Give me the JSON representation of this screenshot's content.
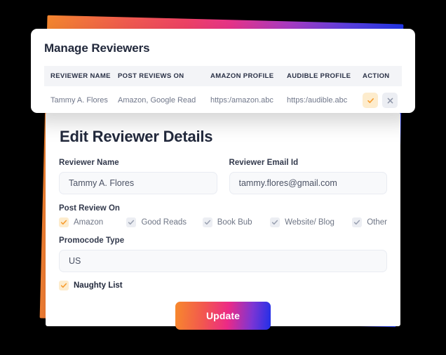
{
  "manage_panel": {
    "title": "Manage Reviewers",
    "table": {
      "columns": [
        "REVIEWER NAME",
        "POST REVIEWS ON",
        "AMAZON PROFILE",
        "AUDIBLE PROFILE",
        "ACTION"
      ],
      "rows": [
        {
          "reviewer_name": "Tammy A. Flores",
          "post_reviews_on": "Amazon, Google Read",
          "amazon_profile": "https:/amazon.abc",
          "audible_profile": "https:/audible.abc",
          "actions": {
            "approve_icon": "check-icon",
            "remove_icon": "close-icon"
          }
        }
      ]
    }
  },
  "edit_panel": {
    "title": "Edit Reviewer Details",
    "fields": {
      "reviewer_name": {
        "label": "Reviewer Name",
        "value": "Tammy A. Flores",
        "placeholder": "Reviewer Name"
      },
      "reviewer_email": {
        "label": "Reviewer Email Id",
        "value": "tammy.flores@gmail.com",
        "placeholder": "Reviewer Email Id"
      },
      "promocode_type": {
        "label": "Promocode Type",
        "value": "US",
        "placeholder": "Promocode Type"
      }
    },
    "post_review_on": {
      "label": "Post Review On",
      "options": [
        {
          "label": "Amazon",
          "checked": true,
          "highlight": true
        },
        {
          "label": "Good Reads",
          "checked": true,
          "highlight": false
        },
        {
          "label": "Book Bub",
          "checked": true,
          "highlight": false
        },
        {
          "label": "Website/ Blog",
          "checked": true,
          "highlight": false
        },
        {
          "label": "Other",
          "checked": true,
          "highlight": false
        }
      ]
    },
    "naughty_list": {
      "label": "Naughty List",
      "checked": true
    },
    "submit": {
      "label": "Update"
    }
  },
  "colors": {
    "accent_orange": "#f7892c",
    "accent_pink": "#ec2a86",
    "accent_blue": "#2030e8",
    "check_on_bg": "#fdeccd",
    "check_on_mark": "#f79a2b",
    "check_off_bg": "#eceef3",
    "check_off_mark": "#9aa1b1",
    "text_dark": "#22293c",
    "text_muted": "#70778a",
    "input_bg": "#f8f9fb",
    "table_header_bg": "#f3f4f7",
    "canvas": "#000000"
  }
}
